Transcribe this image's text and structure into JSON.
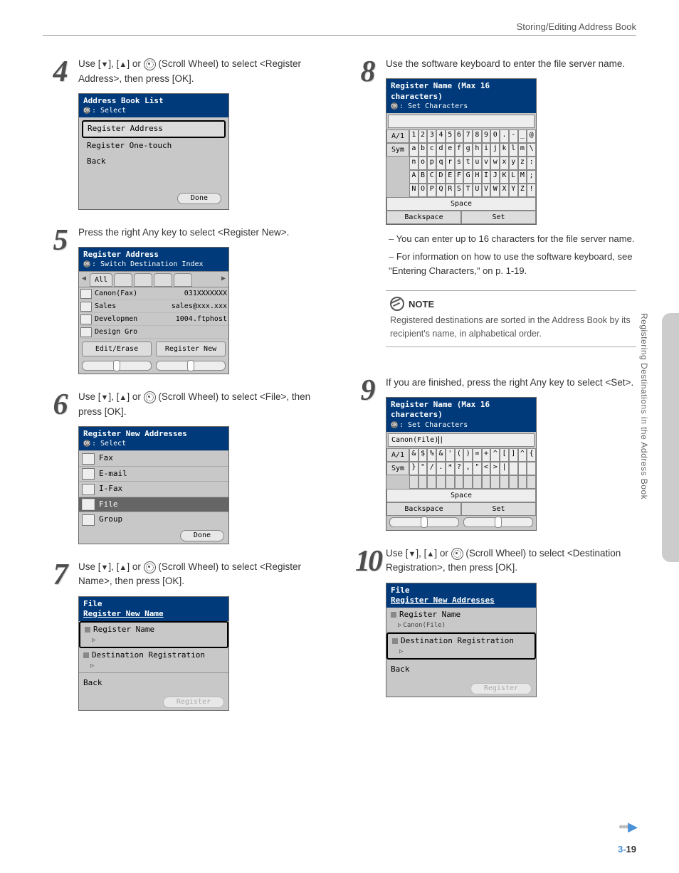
{
  "header": {
    "title": "Storing/Editing Address Book"
  },
  "side_label": "Registering Destinations in the Address Book",
  "page_number": {
    "chapter": "3-",
    "page": "19"
  },
  "left": {
    "s4": {
      "text_a": "Use [",
      "text_b": "], [",
      "text_c": "] or ",
      "text_d": " (Scroll Wheel) to select <Register Address>, then press [OK].",
      "shot": {
        "title": "Address Book List",
        "sub": ": Select",
        "items": [
          "Register Address",
          "Register One-touch",
          "Back"
        ],
        "done": "Done"
      }
    },
    "s5": {
      "text": "Press the right Any key to select <Register New>.",
      "shot": {
        "title": "Register Address",
        "sub": ": Switch Destination Index",
        "tab": "All",
        "rows": [
          {
            "name": "Canon(Fax)",
            "val": "031XXXXXXX"
          },
          {
            "name": "Sales",
            "val": "sales@xxx.xxx"
          },
          {
            "name": "Developmen",
            "val": "1004.ftphost"
          },
          {
            "name": "Design Gro",
            "val": ""
          }
        ],
        "btn_left": "Edit/Erase",
        "btn_right": "Register New"
      }
    },
    "s6": {
      "text_d": " (Scroll Wheel) to select <File>, then press [OK].",
      "shot": {
        "title": "Register New Addresses",
        "sub": ": Select",
        "items": [
          "Fax",
          "E-mail",
          "I-Fax",
          "File",
          "Group"
        ],
        "done": "Done"
      }
    },
    "s7": {
      "text_d": " (Scroll Wheel) to select <Register Name>, then press [OK].",
      "shot": {
        "title": "File",
        "title2": "Register New Name",
        "i1": "Register Name",
        "i2": "Destination Registration",
        "back": "Back",
        "register": "Register"
      }
    }
  },
  "right": {
    "s8": {
      "text": "Use the software keyboard to enter the file server name.",
      "shot": {
        "title": "Register Name (Max 16 characters)",
        "sub": ": Set Characters",
        "side": [
          "A/1",
          "Sym"
        ],
        "row1": [
          "1",
          "2",
          "3",
          "4",
          "5",
          "6",
          "7",
          "8",
          "9",
          "0",
          ".",
          "-",
          "_",
          "@"
        ],
        "row2": [
          "a",
          "b",
          "c",
          "d",
          "e",
          "f",
          "g",
          "h",
          "i",
          "j",
          "k",
          "l",
          "m",
          "\\"
        ],
        "row3": [
          "n",
          "o",
          "p",
          "q",
          "r",
          "s",
          "t",
          "u",
          "v",
          "w",
          "x",
          "y",
          "z",
          ":"
        ],
        "row4": [
          "A",
          "B",
          "C",
          "D",
          "E",
          "F",
          "G",
          "H",
          "I",
          "J",
          "K",
          "L",
          "M",
          ";"
        ],
        "row5": [
          "N",
          "O",
          "P",
          "Q",
          "R",
          "S",
          "T",
          "U",
          "V",
          "W",
          "X",
          "Y",
          "Z",
          "!"
        ],
        "space": "Space",
        "backspace": "Backspace",
        "set": "Set"
      },
      "bullets": [
        "You can enter up to 16 characters for the file server name.",
        "For information on how to use the software keyboard, see \"Entering Characters,\" on p. 1-19."
      ]
    },
    "note": {
      "title": "NOTE",
      "text": "Registered destinations are sorted in the Address Book by its recipient's name, in alphabetical order."
    },
    "s9": {
      "text": "If you are finished, press the right Any key to select <Set>.",
      "shot": {
        "title": "Register Name (Max 16 characters)",
        "sub": ": Set Characters",
        "entry": "Canon(File)",
        "side": [
          "A/1",
          "Sym"
        ],
        "row1": [
          "&",
          "$",
          "%",
          "&",
          "'",
          "(",
          ")",
          "=",
          "+",
          "^",
          "[",
          "]",
          "^",
          "{"
        ],
        "row2": [
          "}",
          "\"",
          "/",
          ".",
          "*",
          "?",
          ",",
          "\"",
          "<",
          ">",
          "|",
          "",
          "",
          ""
        ],
        "space": "Space",
        "backspace": "Backspace",
        "set": "Set"
      }
    },
    "s10": {
      "text_d": " (Scroll Wheel) to select <Destination Registration>, then press [OK].",
      "shot": {
        "title": "File",
        "title2": "Register New Addresses",
        "i1": "Register Name",
        "i1sub": "Canon(File)",
        "i2": "Destination Registration",
        "back": "Back",
        "register": "Register"
      }
    }
  }
}
